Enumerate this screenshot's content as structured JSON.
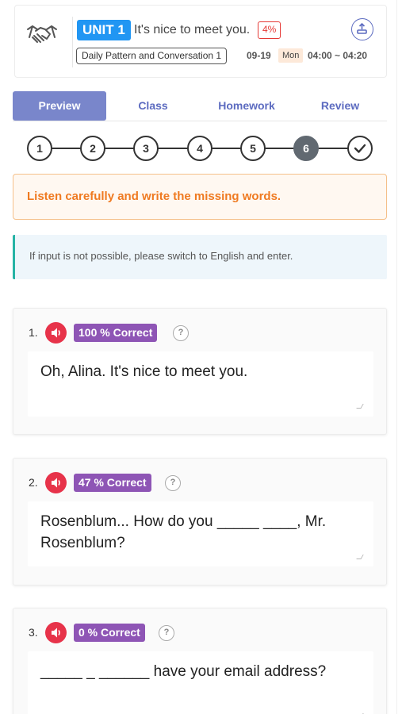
{
  "header": {
    "unit_label": "UNIT 1",
    "title": "It's nice to meet you.",
    "progress": "4%",
    "course": "Daily Pattern and Conversation 1",
    "date": "09-19",
    "day": "Mon",
    "time": "04:00 ~ 04:20",
    "colors": {
      "unit_badge": "#2196f3",
      "progress_badge": "#e53935"
    }
  },
  "tabs": [
    {
      "label": "Preview",
      "active": true
    },
    {
      "label": "Class",
      "active": false
    },
    {
      "label": "Homework",
      "active": false
    },
    {
      "label": "Review",
      "active": false
    }
  ],
  "stepper": {
    "steps": [
      "1",
      "2",
      "3",
      "4",
      "5",
      "6"
    ],
    "current": "6",
    "final_icon": "check-icon"
  },
  "instruction": "Listen carefully and write the missing words.",
  "note": "If input is not possible, please switch to English and enter.",
  "questions": [
    {
      "number": "1.",
      "score": "100 % Correct",
      "answer": "Oh, Alina. It's nice to meet you."
    },
    {
      "number": "2.",
      "score": "47 % Correct",
      "answer": "Rosenblum... How do you _____ ____, Mr. Rosenblum?"
    },
    {
      "number": "3.",
      "score": "0 % Correct",
      "answer": "_____ _ ______ have your email address?"
    }
  ],
  "help_glyph": "?",
  "icons": {
    "header": "handshake-icon",
    "export": "export-icon",
    "play": "speaker-icon",
    "help": "help-icon"
  }
}
